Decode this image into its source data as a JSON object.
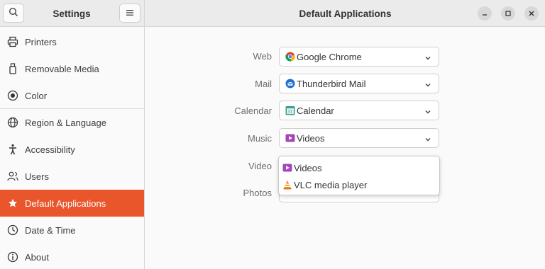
{
  "header": {
    "sidebar_title": "Settings",
    "main_title": "Default Applications",
    "icons": [
      "search-icon",
      "hamburger-menu-icon",
      "minimize-icon",
      "maximize-icon",
      "close-icon"
    ]
  },
  "sidebar": {
    "items": [
      {
        "label": "Printers",
        "icon": "printer-icon"
      },
      {
        "label": "Removable Media",
        "icon": "usb-drive-icon"
      },
      {
        "label": "Color",
        "icon": "palette-icon"
      },
      {
        "label": "Region & Language",
        "icon": "globe-icon"
      },
      {
        "label": "Accessibility",
        "icon": "accessibility-icon"
      },
      {
        "label": "Users",
        "icon": "users-icon"
      },
      {
        "label": "Default Applications",
        "icon": "star-icon",
        "selected": true
      },
      {
        "label": "Date & Time",
        "icon": "clock-icon"
      },
      {
        "label": "About",
        "icon": "info-icon"
      }
    ]
  },
  "main": {
    "rows": [
      {
        "label": "Web",
        "value": "Google Chrome",
        "icon": "chrome-icon"
      },
      {
        "label": "Mail",
        "value": "Thunderbird Mail",
        "icon": "thunderbird-icon"
      },
      {
        "label": "Calendar",
        "value": "Calendar",
        "icon": "calendar-icon"
      },
      {
        "label": "Music",
        "value": "Videos",
        "icon": "videos-icon"
      },
      {
        "label": "Video",
        "value": "",
        "icon": ""
      },
      {
        "label": "Photos",
        "value": "",
        "icon": ""
      }
    ],
    "dropdown": {
      "options": [
        {
          "label": "Videos",
          "icon": "videos-icon"
        },
        {
          "label": "VLC media player",
          "icon": "vlc-icon"
        }
      ]
    }
  },
  "colors": {
    "accent": "#e9562c",
    "headerbar": "#ebebeb",
    "background": "#fafafa"
  }
}
